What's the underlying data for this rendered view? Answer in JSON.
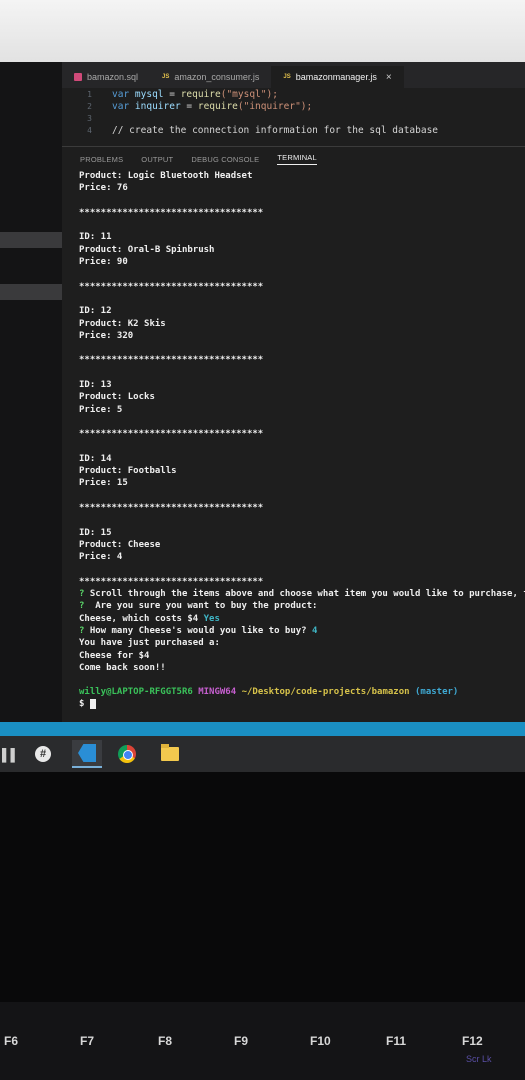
{
  "editor": {
    "tabs": [
      {
        "label": "bamazon.sql",
        "icon": "sql-file-icon",
        "active": false
      },
      {
        "label": "amazon_consumer.js",
        "icon": "js-file-icon",
        "active": false
      },
      {
        "label": "bamazonmanager.js",
        "icon": "js-file-icon",
        "active": true
      }
    ],
    "close_glyph": "×",
    "code_lines": [
      {
        "num": "1",
        "kw": "var",
        "name": "mysql",
        "eq": " = ",
        "fn": "require",
        "arg": "(\"mysql\");"
      },
      {
        "num": "2",
        "kw": "var",
        "name": "inquirer",
        "eq": " = ",
        "fn": "require",
        "arg": "(\"inquirer\");"
      },
      {
        "num": "3",
        "comment": ""
      },
      {
        "num": "4",
        "comment": "// create the connection information for the sql database"
      }
    ]
  },
  "panel": {
    "tabs": [
      "PROBLEMS",
      "OUTPUT",
      "DEBUG CONSOLE",
      "TERMINAL"
    ],
    "active_tab": "TERMINAL"
  },
  "terminal": {
    "lines": [
      {
        "text": "Product: Logic Bluetooth Headset"
      },
      {
        "text": "Price: 76"
      },
      {
        "text": ""
      },
      {
        "text": "**********************************"
      },
      {
        "text": ""
      },
      {
        "text": "ID: 11"
      },
      {
        "text": "Product: Oral-B Spinbrush"
      },
      {
        "text": "Price: 90"
      },
      {
        "text": ""
      },
      {
        "text": "**********************************"
      },
      {
        "text": ""
      },
      {
        "text": "ID: 12"
      },
      {
        "text": "Product: K2 Skis"
      },
      {
        "text": "Price: 320"
      },
      {
        "text": ""
      },
      {
        "text": "**********************************"
      },
      {
        "text": ""
      },
      {
        "text": "ID: 13"
      },
      {
        "text": "Product: Locks"
      },
      {
        "text": "Price: 5"
      },
      {
        "text": ""
      },
      {
        "text": "**********************************"
      },
      {
        "text": ""
      },
      {
        "text": "ID: 14"
      },
      {
        "text": "Product: Footballs"
      },
      {
        "text": "Price: 15"
      },
      {
        "text": ""
      },
      {
        "text": "**********************************"
      },
      {
        "text": ""
      },
      {
        "text": "ID: 15"
      },
      {
        "text": "Product: Cheese"
      },
      {
        "text": "Price: 4"
      },
      {
        "text": ""
      },
      {
        "text": "**********************************"
      }
    ],
    "prompts": [
      {
        "mark": "?",
        "text": " Scroll through the items above and choose what item you would like to purchase, t",
        "answer": ""
      },
      {
        "mark": "?",
        "text": "  Are you sure you want to buy the product:",
        "answer": ""
      },
      {
        "mark": "",
        "text": "Cheese, which costs $4",
        "answer": " Yes"
      },
      {
        "mark": "?",
        "text": " How many Cheese's would you like to buy?",
        "answer": " 4"
      },
      {
        "mark": "",
        "text": "You have just purchased a:",
        "answer": ""
      },
      {
        "mark": "",
        "text": "Cheese for $4",
        "answer": ""
      },
      {
        "mark": "",
        "text": "Come back soon!!",
        "answer": ""
      }
    ],
    "shell": {
      "user": "willy@LAPTOP-RFGGT5R6",
      "env": "MINGW64",
      "path": "~/Desktop/code-projects/bamazon",
      "branch": "(master)",
      "prompt": "$"
    }
  },
  "taskbar": {
    "apps": [
      "slack-icon",
      "vscode-icon",
      "chrome-icon",
      "file-explorer-icon"
    ]
  },
  "keyboard": {
    "keys": [
      "F6",
      "F7",
      "F8",
      "F9",
      "F10",
      "F11",
      "F12"
    ],
    "f12_sub": "Scr Lk"
  },
  "colors": {
    "terminal_bg": "#1e1e1e",
    "statusbar": "#1a8fc3",
    "prompt_green": "#5bd66a",
    "answer_cyan": "#3fb6c6"
  }
}
